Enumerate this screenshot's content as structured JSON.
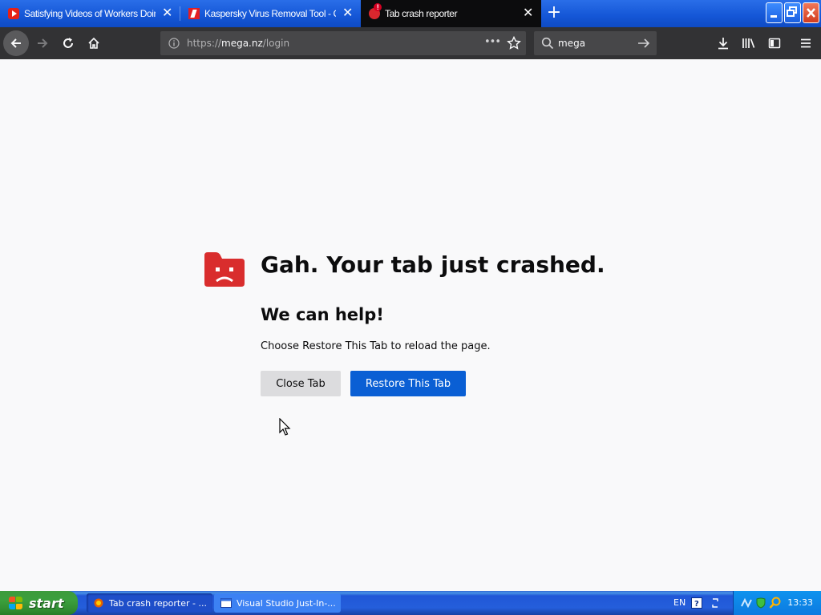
{
  "tabs": [
    {
      "label": "Satisfying Videos of Workers Doing",
      "icon": "youtube-icon",
      "active": false
    },
    {
      "label": "Kaspersky Virus Removal Tool - Ce",
      "icon": "kaspersky-icon",
      "active": false
    },
    {
      "label": "Tab crash reporter",
      "icon": "mega-icon",
      "active": true
    }
  ],
  "tab_close_glyph": "✕",
  "new_tab_glyph": "+",
  "navbar": {
    "url_prefix": "https://",
    "url_domain": "mega.nz",
    "url_path": "/login",
    "page_actions_glyph": "•••",
    "search_value": "mega"
  },
  "crash": {
    "title": "Gah. Your tab just crashed.",
    "subtitle": "We can help!",
    "description": "Choose Restore This Tab to reload the page.",
    "close_button": "Close Tab",
    "restore_button": "Restore This Tab"
  },
  "taskbar": {
    "start_label": "start",
    "items": [
      {
        "label": "Tab crash reporter - ...",
        "icon": "firefox-icon"
      },
      {
        "label": "Visual Studio Just-In-...",
        "icon": "window-icon"
      }
    ],
    "language": "EN",
    "clock": "13:33"
  },
  "colors": {
    "tabstrip": "#1456d6",
    "active_tab": "#0c0c0d",
    "navbar": "#323234",
    "restore_button": "#0a5fd4",
    "crash_icon": "#d92d2d",
    "start_button": "#3b9f3d"
  }
}
